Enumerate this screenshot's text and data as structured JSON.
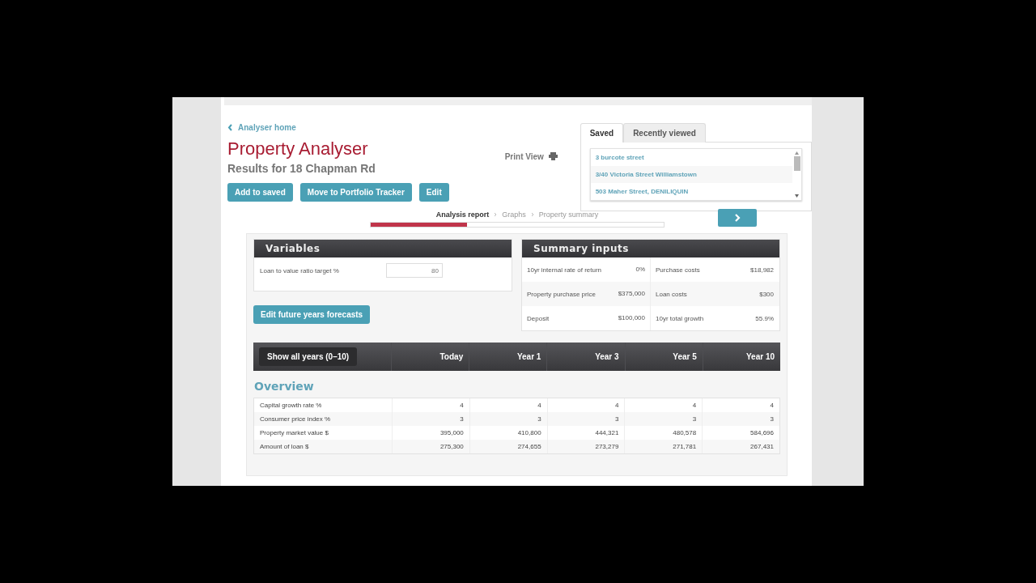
{
  "back_link": {
    "label": "Analyser home"
  },
  "title": "Property Analyser",
  "subtitle": "Results for 18 Chapman Rd",
  "actions": [
    "Add to saved",
    "Move to Portfolio Tracker",
    "Edit"
  ],
  "print_view": {
    "label": "Print View"
  },
  "saved_panel": {
    "tabs": [
      {
        "label": "Saved",
        "selected": true
      },
      {
        "label": "Recently viewed",
        "selected": false
      }
    ],
    "items": [
      "3 burcote street",
      "3/40 Victoria Street Williamstown",
      "503 Maher Street, DENILIQUIN"
    ]
  },
  "steps": [
    {
      "label": "Analysis report",
      "selected": true
    },
    {
      "label": "Graphs",
      "selected": false
    },
    {
      "label": "Property summary",
      "selected": false
    }
  ],
  "progress": {
    "level": 0.33
  },
  "variables": {
    "title": "Variables",
    "fields": [
      {
        "label": "Loan to value ratio target %",
        "value": "80"
      }
    ],
    "button": "Edit future years forecasts"
  },
  "summary_inputs": {
    "title": "Summary inputs",
    "rows": [
      [
        "10yr internal rate of return",
        "0%",
        "Purchase costs",
        "$18,982"
      ],
      [
        "Property purchase price",
        "$375,000",
        "Loan costs",
        "$300"
      ],
      [
        "Deposit",
        "$100,000",
        "10yr total growth",
        "55.9%"
      ]
    ]
  },
  "years_table": {
    "toggle": "Show all years (0–10)",
    "columns": [
      "Today",
      "Year 1",
      "Year 3",
      "Year 5",
      "Year 10"
    ],
    "section": "Overview",
    "rows": [
      {
        "label": "Capital growth rate %",
        "values": [
          "4",
          "4",
          "4",
          "4",
          "4"
        ]
      },
      {
        "label": "Consumer price index %",
        "values": [
          "3",
          "3",
          "3",
          "3",
          "3"
        ]
      },
      {
        "label": "Property market value $",
        "values": [
          "395,000",
          "410,800",
          "444,321",
          "480,578",
          "584,696"
        ]
      },
      {
        "label": "Amount of loan $",
        "values": [
          "275,300",
          "274,655",
          "273,279",
          "271,781",
          "267,431"
        ]
      }
    ]
  }
}
